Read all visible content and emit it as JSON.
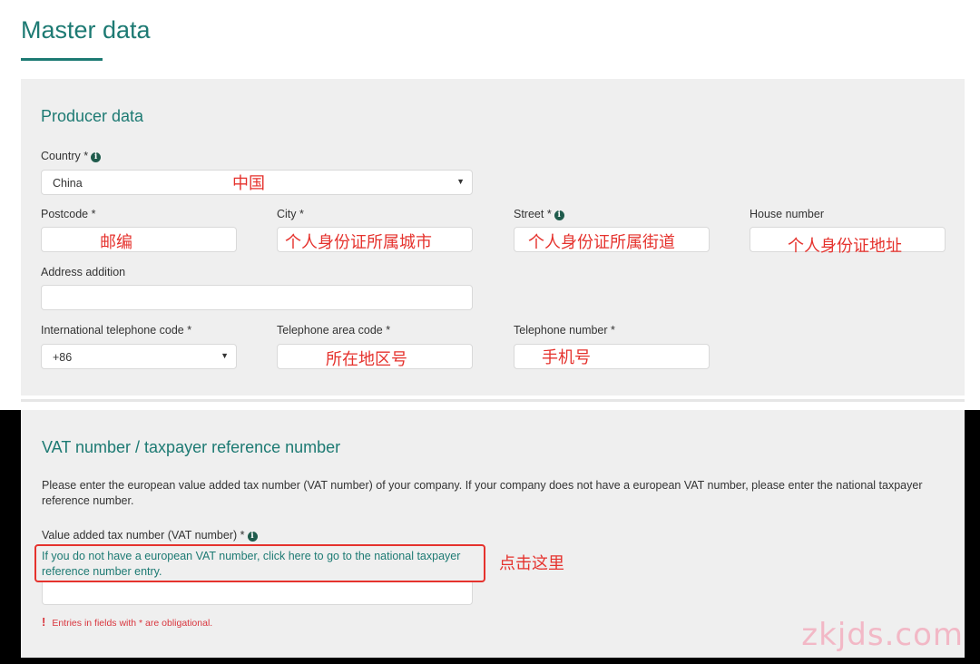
{
  "page": {
    "title": "Master data"
  },
  "producer": {
    "heading": "Producer data",
    "country": {
      "label": "Country *",
      "value": "China",
      "annotation": "中国"
    },
    "postcode": {
      "label": "Postcode *",
      "annotation": "邮编"
    },
    "city": {
      "label": "City *",
      "annotation": "个人身份证所属城市"
    },
    "street": {
      "label": "Street *",
      "annotation": "个人身份证所属街道"
    },
    "house_number": {
      "label": "House number",
      "annotation": "个人身份证地址"
    },
    "address_addition": {
      "label": "Address addition"
    },
    "intl_code": {
      "label": "International telephone code *",
      "value": "+86"
    },
    "area_code": {
      "label": "Telephone area code *",
      "annotation": "所在地区号"
    },
    "phone": {
      "label": "Telephone number *",
      "annotation": "手机号"
    }
  },
  "vat": {
    "heading": "VAT number / taxpayer reference number",
    "description": "Please enter the european value added tax number (VAT number) of your company. If your company does not have a european VAT number, please enter the national taxpayer reference number.",
    "field_label": "Value added tax number (VAT number) *",
    "link_text": "If you do not have a european VAT number, click here to go to the national taxpayer reference number entry.",
    "annotation": "点击这里",
    "error_mark": "!",
    "error_text": "Entries in fields with * are obligational."
  },
  "watermark": "zkjds.com",
  "icons": {
    "info": "info-icon",
    "dropdown": "chevron-down-icon"
  },
  "colors": {
    "accent": "#1d7a73",
    "annotation": "#e5322d",
    "error": "#d9363e",
    "panel": "#efefef"
  }
}
